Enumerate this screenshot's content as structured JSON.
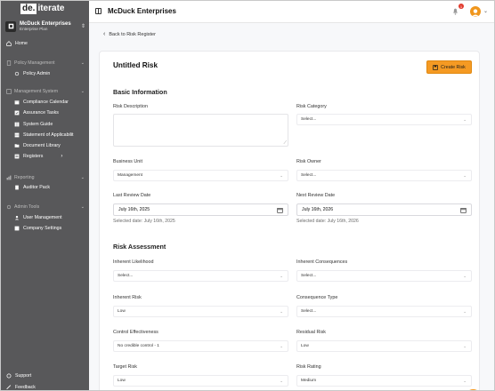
{
  "logo": {
    "box": "de.",
    "rest": "iterate"
  },
  "org": {
    "name": "McDuck Enterprises",
    "plan": "Enterprise Plan"
  },
  "sidebar": {
    "home": "Home",
    "policy_section": "Policy Management",
    "policy_admin": "Policy Admin",
    "management_section": "Management System",
    "compliance_calendar": "Compliance Calendar",
    "assurance_tasks": "Assurance Tasks",
    "system_guide": "System Guide",
    "statement_applicability": "Statement of Applicabilit",
    "document_library": "Document Library",
    "registers": "Registers",
    "reporting_section": "Reporting",
    "auditor_pack": "Auditor Pack",
    "admin_section": "Admin Tools",
    "user_management": "User Management",
    "company_settings": "Company Settings",
    "support": "Support",
    "feedback": "Feedback"
  },
  "topbar": {
    "title": "McDuck Enterprises",
    "notification_count": "1"
  },
  "main": {
    "back_label": "Back to Risk Register"
  },
  "form": {
    "title": "Untitled Risk",
    "create_label": "Create Risk",
    "basic_heading": "Basic Information",
    "risk_description_label": "Risk Description",
    "risk_category_label": "Risk Category",
    "risk_category_value": "Select...",
    "business_unit_label": "Business Unit",
    "business_unit_value": "Management",
    "risk_owner_label": "Risk Owner",
    "risk_owner_value": "Select...",
    "last_review_label": "Last Review Date",
    "last_review_value": "July 16th, 2025",
    "last_review_hint": "Selected date: July 16th, 2025",
    "next_review_label": "Next Review Date",
    "next_review_value": "July 16th, 2026",
    "next_review_hint": "Selected date: July 16th, 2026",
    "assessment_heading": "Risk Assessment",
    "inherent_likelihood_label": "Inherent Likelihood",
    "inherent_likelihood_value": "Select...",
    "inherent_consequences_label": "Inherent Consequences",
    "inherent_consequences_value": "Select...",
    "inherent_risk_label": "Inherent Risk",
    "inherent_risk_value": "Low",
    "consequence_type_label": "Consequence Type",
    "consequence_type_value": "Select...",
    "control_effectiveness_label": "Control Effectiveness",
    "control_effectiveness_value": "No credible control - 1",
    "residual_risk_label": "Residual Risk",
    "residual_risk_value": "Low",
    "target_risk_label": "Target Risk",
    "target_risk_value": "Low",
    "risk_rating_label": "Risk Rating",
    "risk_rating_value": "Medium"
  },
  "colors": {
    "sidebar_bg": "#58585a",
    "accent": "#f59a23",
    "badge": "#e23b2e"
  },
  "icons": [
    "home-icon",
    "document-icon",
    "settings-icon",
    "calendar-icon",
    "tasks-icon",
    "book-icon",
    "table-icon",
    "folder-icon",
    "registers-icon",
    "chart-icon",
    "tools-icon",
    "user-icon",
    "gear-icon",
    "support-icon",
    "feedback-icon",
    "bell-icon",
    "save-icon",
    "help-icon"
  ]
}
